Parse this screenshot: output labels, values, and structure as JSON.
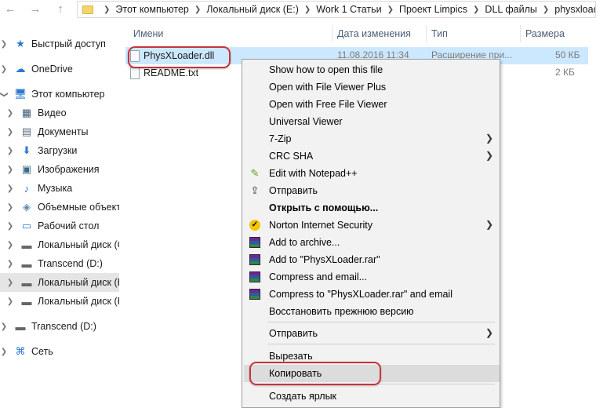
{
  "address": {
    "back_icon": "←",
    "forward_icon": "→",
    "up_icon": "↑",
    "crumbs": [
      "Этот компьютер",
      "Локальный диск (E:)",
      "Work 1 Статьи",
      "Проект Limpics",
      "DLL файлы",
      "physxloader.dll"
    ]
  },
  "sidebar": {
    "items": [
      {
        "label": "Быстрый доступ",
        "icon": "★"
      },
      {
        "label": "OneDrive",
        "icon": "☁"
      },
      {
        "label": "Этот компьютер",
        "icon": "🖥"
      },
      {
        "label": "Видео",
        "icon": "▦"
      },
      {
        "label": "Документы",
        "icon": "▤"
      },
      {
        "label": "Загрузки",
        "icon": "⬇"
      },
      {
        "label": "Изображения",
        "icon": "▣"
      },
      {
        "label": "Музыка",
        "icon": "♪"
      },
      {
        "label": "Объемные объекты",
        "icon": "◈"
      },
      {
        "label": "Рабочий стол",
        "icon": "▭"
      },
      {
        "label": "Локальный диск (C:)",
        "icon": "▬"
      },
      {
        "label": "Transcend (D:)",
        "icon": "▬"
      },
      {
        "label": "Локальный диск (E:)",
        "icon": "▬"
      },
      {
        "label": "Локальный диск (F:)",
        "icon": "▬"
      },
      {
        "label": "Transcend (D:)",
        "icon": "▬"
      },
      {
        "label": "Сеть",
        "icon": "⌘"
      }
    ]
  },
  "columns": {
    "name": "Имени",
    "date": "Дата изменения",
    "type": "Тип",
    "size": "Размера"
  },
  "files": [
    {
      "name": "PhysXLoader.dll",
      "date": "11.08.2016 11:34",
      "type": "Расширение при...",
      "size": "50 КБ"
    },
    {
      "name": "README.txt",
      "date": "",
      "type": "",
      "size": "2 КБ"
    }
  ],
  "context_menu": {
    "items": [
      {
        "label": "Show how to open this file"
      },
      {
        "label": "Open with File Viewer Plus"
      },
      {
        "label": "Open with Free File Viewer"
      },
      {
        "label": "Universal Viewer"
      },
      {
        "label": "7-Zip"
      },
      {
        "label": "CRC SHA"
      },
      {
        "label": "Edit with Notepad++"
      },
      {
        "label": "Отправить"
      },
      {
        "label": "Открыть с помощью..."
      },
      {
        "label": "Norton Internet Security"
      },
      {
        "label": "Add to archive..."
      },
      {
        "label": "Add to \"PhysXLoader.rar\""
      },
      {
        "label": "Compress and email..."
      },
      {
        "label": "Compress to \"PhysXLoader.rar\" and email"
      },
      {
        "label": "Восстановить прежнюю версию"
      },
      {
        "label": "Отправить"
      },
      {
        "label": "Вырезать"
      },
      {
        "label": "Копировать"
      },
      {
        "label": "Создать ярлык"
      }
    ],
    "submenu_glyph": "❯",
    "notepad_icon": "✎",
    "share_icon": "⇪",
    "norton_glyph": "✓"
  },
  "colors": {
    "highlight": "#c8323c",
    "selection": "#cce8ff",
    "menu_bg": "#f2f2f2",
    "hover": "#dcdcdc"
  }
}
